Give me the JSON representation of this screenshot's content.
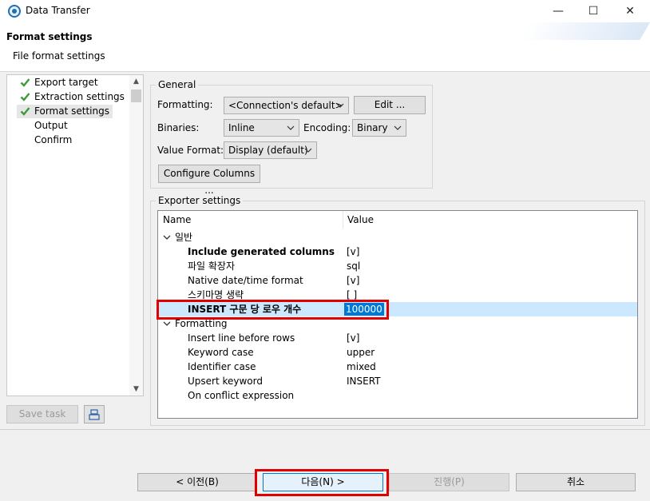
{
  "window": {
    "title": "Data Transfer",
    "controls": {
      "minimize": "—",
      "maximize": "☐",
      "close": "✕"
    }
  },
  "header": {
    "title": "Format settings",
    "subtitle": "File format settings"
  },
  "sidebar": {
    "items": [
      {
        "label": "Export target",
        "checked": true,
        "selected": false
      },
      {
        "label": "Extraction settings",
        "checked": true,
        "selected": false
      },
      {
        "label": "Format settings",
        "checked": true,
        "selected": true
      },
      {
        "label": "Output",
        "checked": false,
        "selected": false
      },
      {
        "label": "Confirm",
        "checked": false,
        "selected": false
      }
    ],
    "save_task_label": "Save task"
  },
  "general": {
    "group_label": "General",
    "formatting_label": "Formatting:",
    "formatting_value": "<Connection's default>",
    "edit_label": "Edit ...",
    "binaries_label": "Binaries:",
    "binaries_value": "Inline",
    "encoding_label": "Encoding:",
    "encoding_value": "Binary",
    "value_format_label": "Value Format:",
    "value_format_value": "Display (default)",
    "configure_columns_label": "Configure Columns ..."
  },
  "exporter": {
    "group_label": "Exporter settings",
    "columns": [
      "Name",
      "Value"
    ],
    "groups": [
      {
        "label": "일반",
        "rows": [
          {
            "name": "Include generated columns",
            "value": "[v]",
            "bold": true
          },
          {
            "name": "파일 확장자",
            "value": "sql",
            "bold": false
          },
          {
            "name": "Native date/time format",
            "value": "[v]",
            "bold": false
          },
          {
            "name": "스키마명 생략",
            "value": "[ ]",
            "bold": false
          },
          {
            "name": "INSERT 구문 당 로우 개수",
            "value": "100000",
            "bold": true,
            "editing": true
          }
        ]
      },
      {
        "label": "Formatting",
        "rows": [
          {
            "name": "Insert line before rows",
            "value": "[v]",
            "bold": false
          },
          {
            "name": "Keyword case",
            "value": "upper",
            "bold": false
          },
          {
            "name": "Identifier case",
            "value": "mixed",
            "bold": false
          },
          {
            "name": "Upsert keyword",
            "value": "INSERT",
            "bold": false
          },
          {
            "name": "On conflict expression",
            "value": "",
            "bold": false
          }
        ]
      }
    ]
  },
  "footer": {
    "back_label": "< 이전(B)",
    "next_label": "다음(N) >",
    "proceed_label": "진행(P)",
    "cancel_label": "취소"
  },
  "colors": {
    "highlight_box": "#e00000",
    "selection": "#0078d7",
    "row_highlight": "#cce8ff",
    "check": "#3c9a3c"
  }
}
